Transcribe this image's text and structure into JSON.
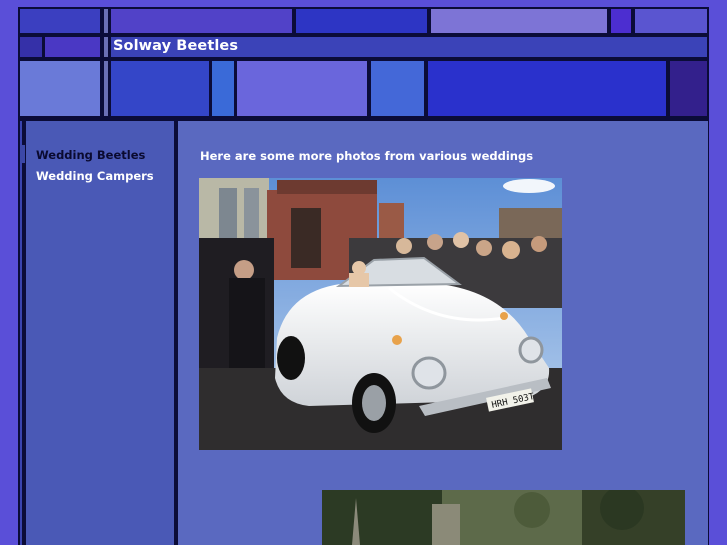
{
  "site": {
    "title": "Solway Beetles"
  },
  "nav": [
    {
      "label": "Wedding Beetles",
      "active": true
    },
    {
      "label": "Wedding Campers",
      "active": false
    }
  ],
  "main": {
    "intro": "Here are some more photos from various weddings",
    "photos": [
      {
        "subject": "white convertible VW Beetle wedding car with guests",
        "plate": "HRH 503T"
      },
      {
        "subject": "church building among trees"
      }
    ]
  },
  "colors": {
    "page_bg": "#5a4fd8",
    "frame": "#0b0c38",
    "sidebar": "#4a59b6",
    "main": "#5a69c0",
    "nav_active": "#0a0a30",
    "nav_text": "#ffffff"
  }
}
